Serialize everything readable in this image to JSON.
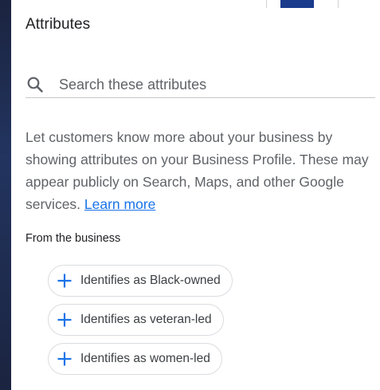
{
  "dialog": {
    "title": "Attributes",
    "search": {
      "placeholder": "Search these attributes",
      "value": ""
    },
    "description": {
      "text": "Let customers know more about your business by showing attributes on your Business Profile. These may appear publicly on Search, Maps, and other Google services. ",
      "link_text": "Learn more"
    },
    "section": {
      "label": "From the business",
      "chips": [
        {
          "label": "Identifies as Black-owned",
          "icon": "plus-icon"
        },
        {
          "label": "Identifies as veteran-led",
          "icon": "plus-icon"
        },
        {
          "label": "Identifies as women-led",
          "icon": "plus-icon"
        }
      ]
    }
  },
  "colors": {
    "accent": "#1a73e8",
    "text_primary": "#202124",
    "text_secondary": "#5f6368",
    "chip_border": "#dadce0"
  }
}
